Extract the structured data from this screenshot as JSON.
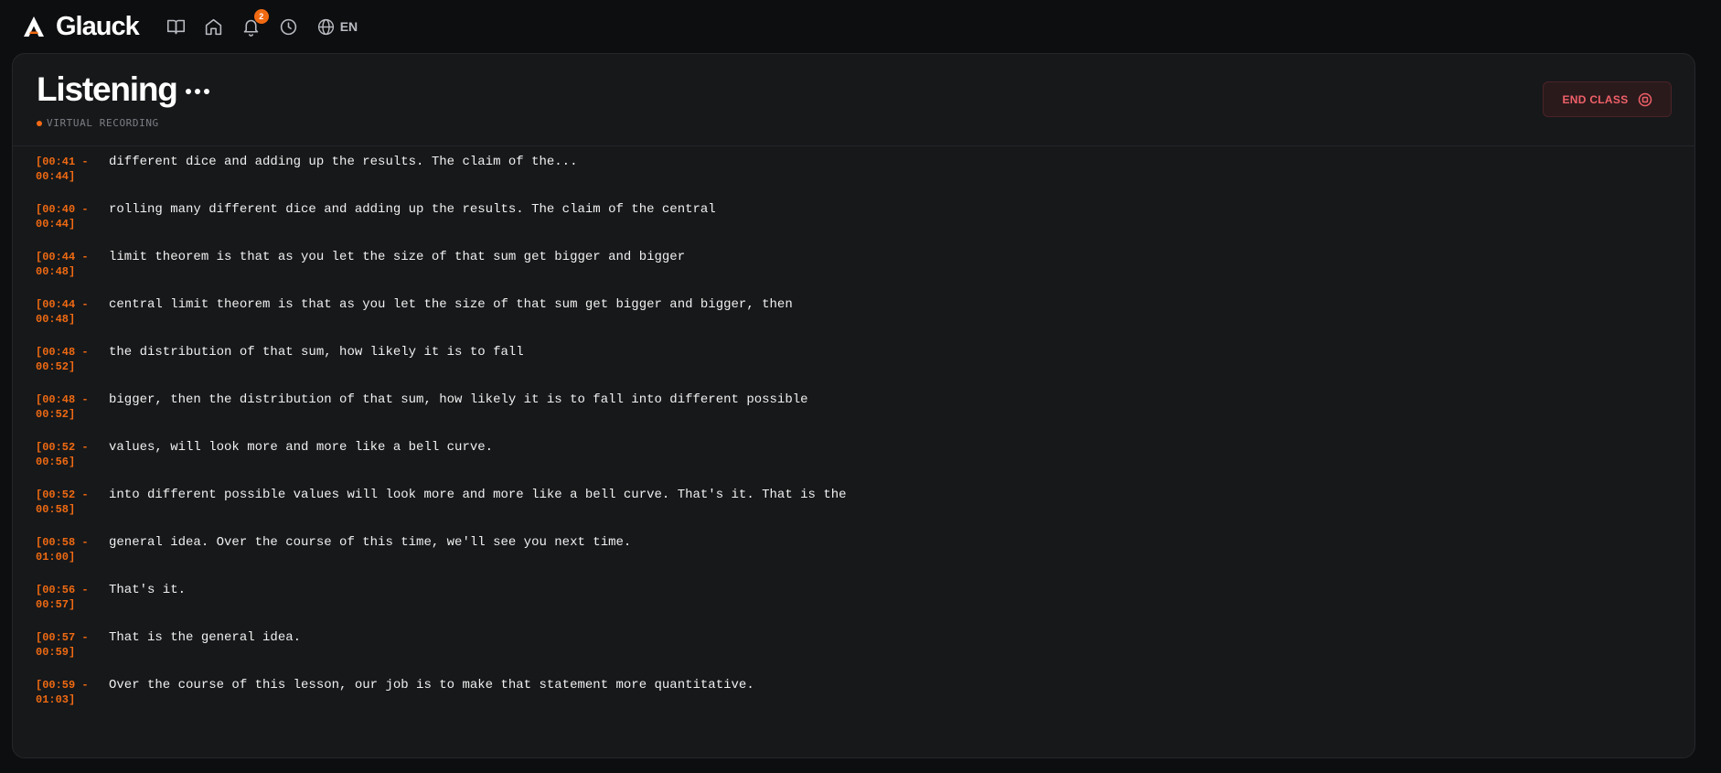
{
  "app": {
    "name": "Glauck"
  },
  "nav": {
    "icons": [
      "book-icon",
      "home-icon",
      "bell-icon",
      "clock-icon",
      "globe-icon"
    ],
    "notification_count": "2",
    "language": "EN"
  },
  "header": {
    "title": "Listening",
    "status": "VIRTUAL RECORDING",
    "end_button": "END CLASS"
  },
  "colors": {
    "accent": "#f06a12",
    "danger": "#f06068",
    "background": "#0d0e10",
    "panel": "#17181a"
  },
  "transcript": [
    {
      "start": "[00:41 -",
      "end": "00:44]",
      "text": "different dice and adding up the results. The claim of the..."
    },
    {
      "start": "[00:40 -",
      "end": "00:44]",
      "text": "rolling many different dice and adding up the results. The claim of the central"
    },
    {
      "start": "[00:44 -",
      "end": "00:48]",
      "text": "limit theorem is that as you let the size of that sum get bigger and bigger"
    },
    {
      "start": "[00:44 -",
      "end": "00:48]",
      "text": "central limit theorem is that as you let the size of that sum get bigger and bigger, then"
    },
    {
      "start": "[00:48 -",
      "end": "00:52]",
      "text": "the distribution of that sum, how likely it is to fall"
    },
    {
      "start": "[00:48 -",
      "end": "00:52]",
      "text": "bigger, then the distribution of that sum, how likely it is to fall into different possible"
    },
    {
      "start": "[00:52 -",
      "end": "00:56]",
      "text": "values, will look more and more like a bell curve."
    },
    {
      "start": "[00:52 -",
      "end": "00:58]",
      "text": "into different possible values will look more and more like a bell curve. That's it. That is the"
    },
    {
      "start": "[00:58 -",
      "end": "01:00]",
      "text": "general idea. Over the course of this time, we'll see you next time."
    },
    {
      "start": "[00:56 -",
      "end": "00:57]",
      "text": "That's it."
    },
    {
      "start": "[00:57 -",
      "end": "00:59]",
      "text": "That is the general idea."
    },
    {
      "start": "[00:59 -",
      "end": "01:03]",
      "text": "Over the course of this lesson, our job is to make that statement more quantitative."
    }
  ]
}
